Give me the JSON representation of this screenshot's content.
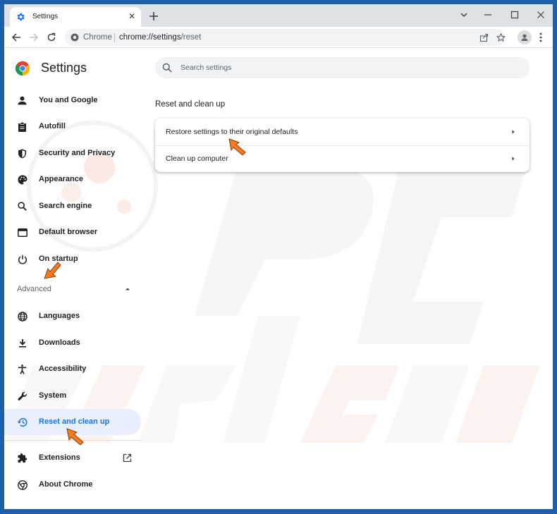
{
  "browser": {
    "tab_title": "Settings",
    "tab_close": "✕",
    "omnibox_site": "Chrome",
    "omnibox_url_host": "chrome://settings",
    "omnibox_url_path": "/reset"
  },
  "sidebar": {
    "title": "Settings",
    "items": [
      {
        "label": "You and Google",
        "icon": "person-icon"
      },
      {
        "label": "Autofill",
        "icon": "clipboard-icon"
      },
      {
        "label": "Security and Privacy",
        "icon": "shield-icon"
      },
      {
        "label": "Appearance",
        "icon": "palette-icon"
      },
      {
        "label": "Search engine",
        "icon": "search-icon"
      },
      {
        "label": "Default browser",
        "icon": "browser-icon"
      },
      {
        "label": "On startup",
        "icon": "power-icon"
      }
    ],
    "advanced_label": "Advanced",
    "advanced_items": [
      {
        "label": "Languages",
        "icon": "globe-icon"
      },
      {
        "label": "Downloads",
        "icon": "download-icon"
      },
      {
        "label": "Accessibility",
        "icon": "accessibility-icon"
      },
      {
        "label": "System",
        "icon": "wrench-icon"
      },
      {
        "label": "Reset and clean up",
        "icon": "history-icon",
        "active": true
      }
    ],
    "extensions_label": "Extensions",
    "about_label": "About Chrome"
  },
  "search": {
    "placeholder": "Search settings"
  },
  "main": {
    "section_title": "Reset and clean up",
    "rows": [
      {
        "label": "Restore settings to their original defaults"
      },
      {
        "label": "Clean up computer"
      }
    ]
  },
  "colors": {
    "accent": "#1a73e8",
    "active_bg": "#e8f0fe",
    "frame": "#dee1e6",
    "annotation_arrow": "#f47b20"
  }
}
